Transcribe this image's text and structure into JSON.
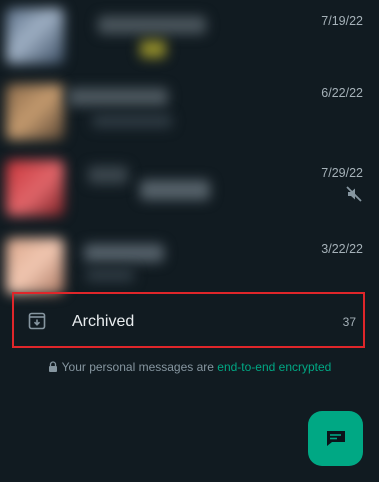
{
  "chats": [
    {
      "date": "7/19/22",
      "muted": false
    },
    {
      "date": "6/22/22",
      "muted": false
    },
    {
      "date": "7/29/22",
      "muted": true,
      "status_icon": "muted-speaker-icon"
    },
    {
      "date": "3/22/22",
      "muted": false
    }
  ],
  "archived": {
    "label": "Archived",
    "count": "37",
    "icon": "archive-icon"
  },
  "encryption_notice": {
    "prefix": "Your personal messages are ",
    "link": "end-to-end encrypted",
    "icon": "lock-icon"
  },
  "fab": {
    "icon": "new-chat-icon"
  },
  "colors": {
    "background": "#111b21",
    "accent": "#00a884",
    "highlight_border": "#e0262a",
    "primary_text": "#e9edef",
    "secondary_text": "#8696a0"
  }
}
